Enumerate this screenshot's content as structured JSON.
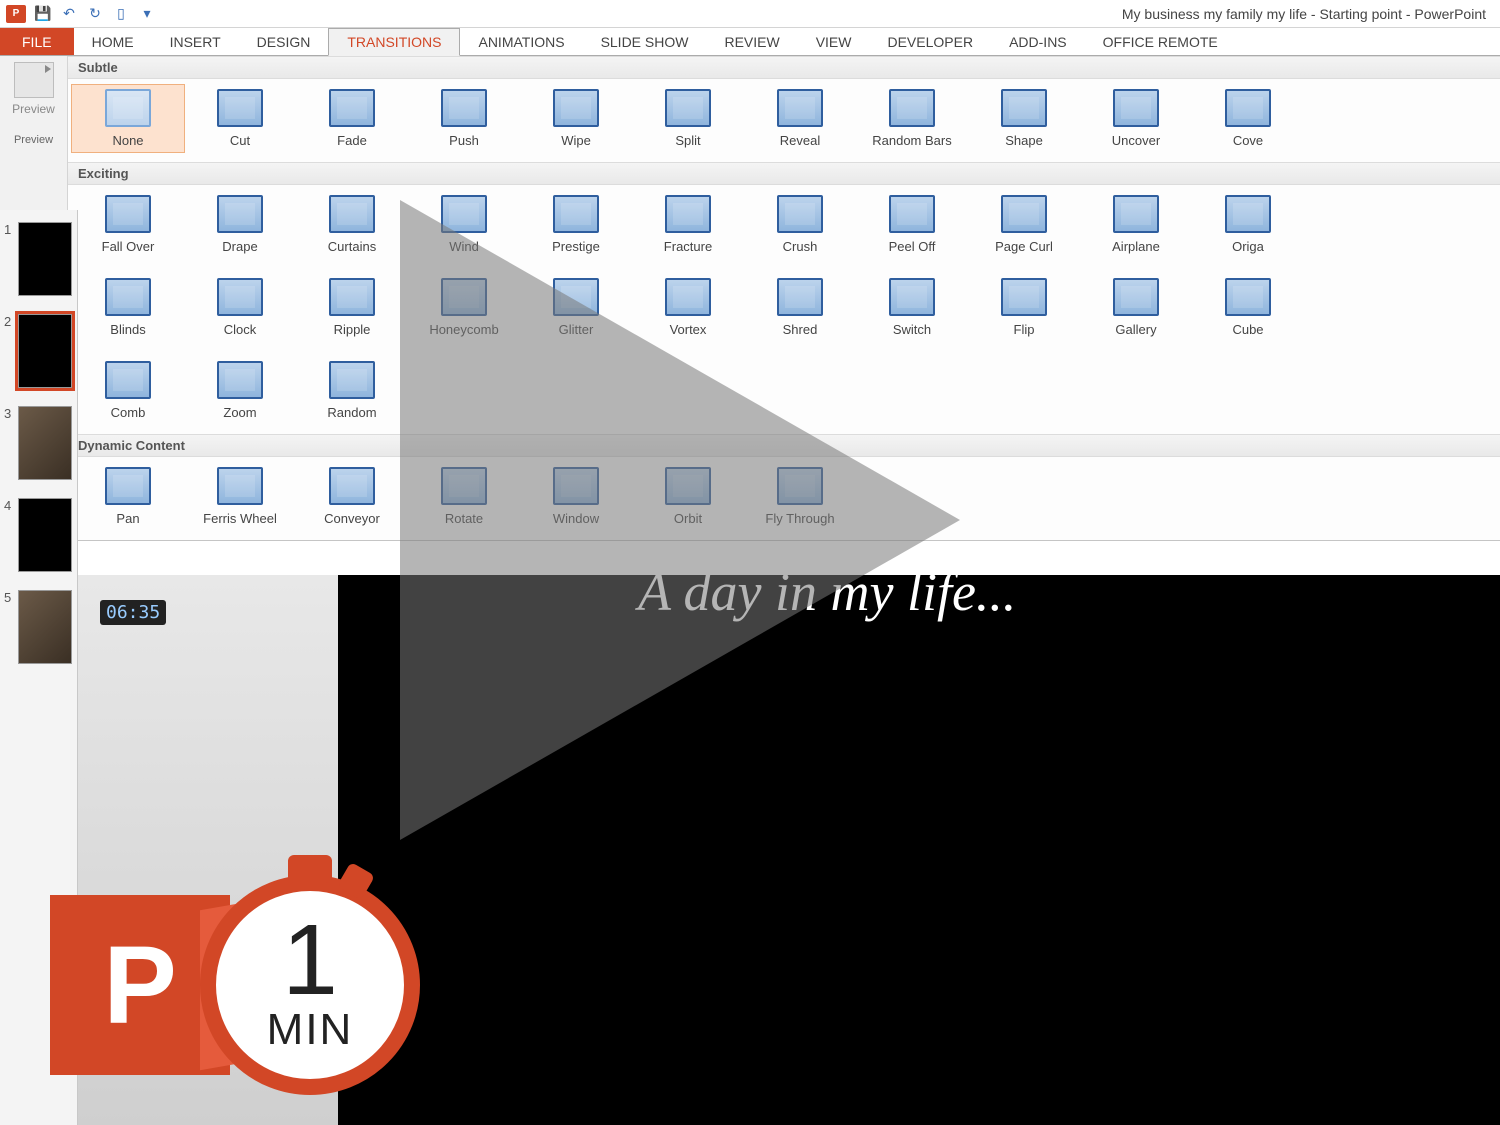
{
  "titlebar": {
    "title": "My business my family my life - Starting point - PowerPoint"
  },
  "tabs": {
    "file": "FILE",
    "list": [
      "HOME",
      "INSERT",
      "DESIGN",
      "TRANSITIONS",
      "ANIMATIONS",
      "SLIDE SHOW",
      "REVIEW",
      "VIEW",
      "DEVELOPER",
      "ADD-INS",
      "OFFICE REMOTE"
    ],
    "active": "TRANSITIONS"
  },
  "preview": {
    "label": "Preview",
    "group": "Preview"
  },
  "categories": {
    "subtle": {
      "title": "Subtle",
      "items": [
        "None",
        "Cut",
        "Fade",
        "Push",
        "Wipe",
        "Split",
        "Reveal",
        "Random Bars",
        "Shape",
        "Uncover",
        "Cove"
      ]
    },
    "exciting": {
      "title": "Exciting",
      "row1": [
        "Fall Over",
        "Drape",
        "Curtains",
        "Wind",
        "Prestige",
        "Fracture",
        "Crush",
        "Peel Off",
        "Page Curl",
        "Airplane",
        "Origa"
      ],
      "row2": [
        "Blinds",
        "Clock",
        "Ripple",
        "Honeycomb",
        "Glitter",
        "Vortex",
        "Shred",
        "Switch",
        "Flip",
        "Gallery",
        "Cube"
      ],
      "row3": [
        "Comb",
        "Zoom",
        "Random"
      ]
    },
    "dynamic": {
      "title": "Dynamic Content",
      "items": [
        "Pan",
        "Ferris Wheel",
        "Conveyor",
        "Rotate",
        "Window",
        "Orbit",
        "Fly Through"
      ]
    }
  },
  "slides": {
    "nums": [
      "1",
      "2",
      "3",
      "4",
      "5"
    ],
    "selected": 2
  },
  "canvas": {
    "text": "A day in my life..."
  },
  "phone": {
    "time": "06:35"
  },
  "badge": {
    "letter": "P",
    "one": "1",
    "min": "MIN"
  }
}
